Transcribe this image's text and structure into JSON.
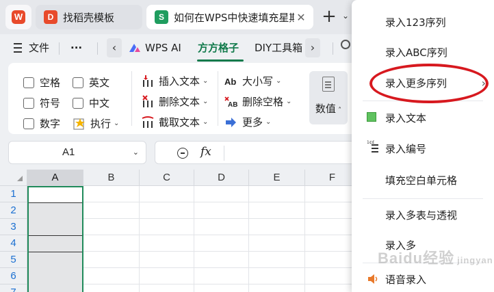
{
  "tabs": [
    {
      "label": "找稻壳模板",
      "icon": "wps-docer-icon"
    },
    {
      "label": "如何在WPS中快速填充星期",
      "icon": "spreadsheet-icon"
    }
  ],
  "menubar": {
    "file": "文件",
    "more": "···",
    "wps_ai": "WPS AI",
    "fangfang": "方方格子",
    "diy": "DIY工具箱"
  },
  "ribbon": {
    "checkboxes": [
      "空格",
      "英文",
      "符号",
      "中文",
      "数字"
    ],
    "execute": "执行",
    "insert_text": "插入文本",
    "delete_text": "删除文本",
    "extract_text": "截取文本",
    "case": "大小写",
    "delete_space": "删除空格",
    "more": "更多",
    "numeric": "数值"
  },
  "formula_bar": {
    "name_box": "A1",
    "fx_label": "fx"
  },
  "grid": {
    "columns": [
      "A",
      "B",
      "C",
      "D",
      "E",
      "F"
    ],
    "rows": [
      "1",
      "2",
      "3",
      "4",
      "5",
      "6",
      "7"
    ]
  },
  "menu": {
    "items": [
      {
        "label": "录入123序列"
      },
      {
        "label": "录入ABC序列"
      },
      {
        "label": "录入更多序列"
      },
      {
        "label": "录入文本"
      },
      {
        "label": "录入编号"
      },
      {
        "label": "填充空白单元格"
      },
      {
        "label": "录入多表与透视"
      },
      {
        "label": "录入多"
      },
      {
        "label": "语音录入"
      }
    ]
  },
  "watermark": "Baidu经验",
  "watermark_sub": "jingyan",
  "colors": {
    "accent": "#117a4b",
    "selection_border": "#1f8a5a",
    "highlight_circle": "#d7191f"
  }
}
